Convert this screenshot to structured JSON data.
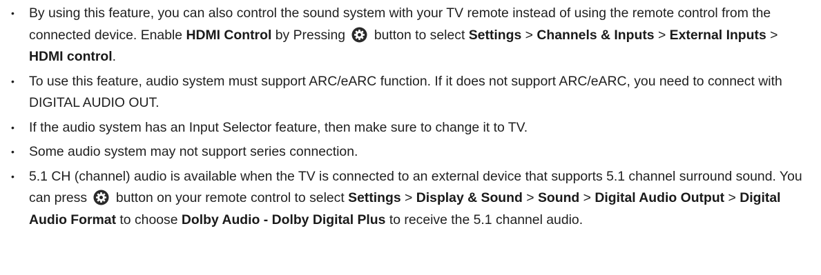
{
  "bullet_char": "•",
  "icons": {
    "settings_button": "gear-icon"
  },
  "notes": [
    {
      "p1": "By using this feature, you can also control the sound system with your TV remote instead of using the remote control from the connected device. Enable ",
      "b1": "HDMI Control",
      "p2": " by Pressing ",
      "p3": " button to select ",
      "b2": "Settings",
      "sep1": " > ",
      "b3": "Channels & Inputs",
      "sep2": " > ",
      "b4": "External Inputs",
      "sep3": " > ",
      "b5": "HDMI control",
      "p4": "."
    },
    {
      "text": "To use this feature, audio system must support ARC/eARC function. If it does not support ARC/eARC, you need to connect with DIGITAL AUDIO OUT."
    },
    {
      "text": "If the audio system has an Input Selector feature, then make sure to change it to TV."
    },
    {
      "text": "Some audio system may not support series connection."
    },
    {
      "p1": "5.1 CH (channel) audio is available when the TV is connected to an external device that supports 5.1 channel surround sound. You can press ",
      "p2": " button on your remote control to select ",
      "b1": "Settings",
      "sep1": " > ",
      "b2": "Display & Sound",
      "sep2": " > ",
      "b3": "Sound",
      "sep3": " > ",
      "b4": "Digital Audio Output",
      "sep4": " > ",
      "b5": "Digital Audio Format",
      "p3": " to choose ",
      "b6": "Dolby Audio - Dolby Digital Plus",
      "p4": " to receive the 5.1 channel audio."
    }
  ]
}
